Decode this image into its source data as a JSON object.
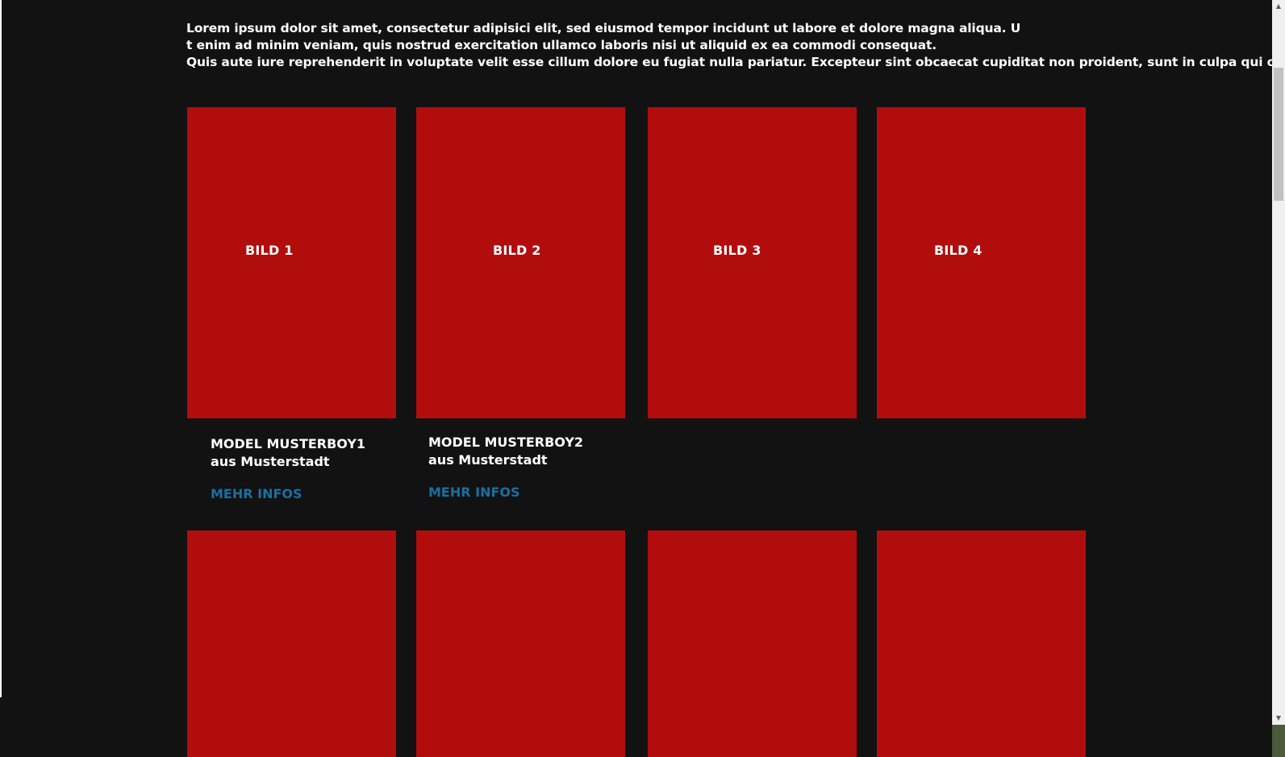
{
  "intro": {
    "lines": [
      "Lorem ipsum dolor sit amet, consectetur adipisici elit, sed eiusmod tempor incidunt ut labore et dolore magna aliqua. U",
      "t enim ad minim veniam, quis nostrud exercitation ullamco laboris nisi ut aliquid ex ea commodi consequat.",
      "Quis aute iure reprehenderit in voluptate velit esse cillum dolore eu fugiat nulla pariatur. Excepteur sint obcaecat cupiditat non proident, sunt in culpa qui officia"
    ]
  },
  "gallery": {
    "row1": [
      {
        "label": "BILD 1"
      },
      {
        "label": "BILD 2"
      },
      {
        "label": "BILD 3"
      },
      {
        "label": "BILD 4"
      }
    ],
    "captions": [
      {
        "name": "MODEL MUSTERBOY1",
        "town": "aus Musterstadt",
        "link": "MEHR INFOS"
      },
      {
        "name": "MODEL MUSTERBOY2",
        "town": "aus Musterstadt",
        "link": "MEHR INFOS"
      }
    ]
  },
  "scrollbar": {
    "up_icon": "▲",
    "down_icon": "▼"
  },
  "colors": {
    "background": "#121212",
    "tile": "#b10d0d",
    "link": "#1a6fa3",
    "text": "#ffffff"
  }
}
